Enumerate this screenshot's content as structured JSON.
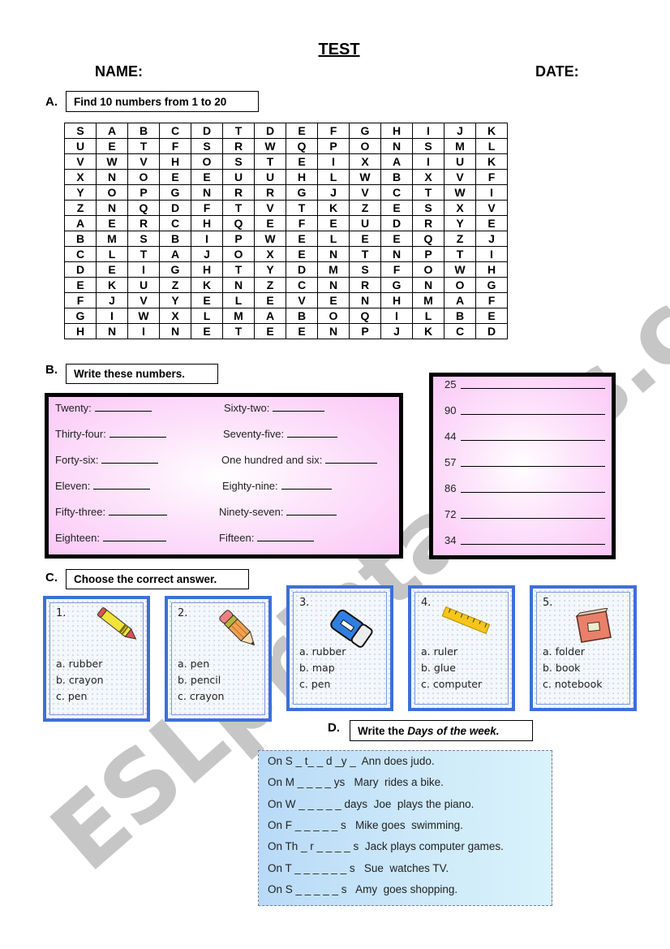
{
  "header": {
    "title": "TEST",
    "name_label": "NAME:",
    "date_label": "DATE:"
  },
  "section_a": {
    "letter": "A.",
    "instruction": "Find 10 numbers from 1 to 20",
    "grid": [
      [
        "S",
        "A",
        "B",
        "C",
        "D",
        "T",
        "D",
        "E",
        "F",
        "G",
        "H",
        "I",
        "J",
        "K"
      ],
      [
        "U",
        "E",
        "T",
        "F",
        "S",
        "R",
        "W",
        "Q",
        "P",
        "O",
        "N",
        "S",
        "M",
        "L"
      ],
      [
        "V",
        "W",
        "V",
        "H",
        "O",
        "S",
        "T",
        "E",
        "I",
        "X",
        "A",
        "I",
        "U",
        "K"
      ],
      [
        "X",
        "N",
        "O",
        "E",
        "E",
        "U",
        "U",
        "H",
        "L",
        "W",
        "B",
        "X",
        "V",
        "F"
      ],
      [
        "Y",
        "O",
        "P",
        "G",
        "N",
        "R",
        "R",
        "G",
        "J",
        "V",
        "C",
        "T",
        "W",
        "I"
      ],
      [
        "Z",
        "N",
        "Q",
        "D",
        "F",
        "T",
        "V",
        "T",
        "K",
        "Z",
        "E",
        "S",
        "X",
        "V"
      ],
      [
        "A",
        "E",
        "R",
        "C",
        "H",
        "Q",
        "E",
        "F",
        "E",
        "U",
        "D",
        "R",
        "Y",
        "E"
      ],
      [
        "B",
        "M",
        "S",
        "B",
        "I",
        "P",
        "W",
        "E",
        "L",
        "E",
        "E",
        "Q",
        "Z",
        "J"
      ],
      [
        "C",
        "L",
        "T",
        "A",
        "J",
        "O",
        "X",
        "E",
        "N",
        "T",
        "N",
        "P",
        "T",
        "I"
      ],
      [
        "D",
        "E",
        "I",
        "G",
        "H",
        "T",
        "Y",
        "D",
        "M",
        "S",
        "F",
        "O",
        "W",
        "H"
      ],
      [
        "E",
        "K",
        "U",
        "Z",
        "K",
        "N",
        "Z",
        "C",
        "N",
        "R",
        "G",
        "N",
        "O",
        "G"
      ],
      [
        "F",
        "J",
        "V",
        "Y",
        "E",
        "L",
        "E",
        "V",
        "E",
        "N",
        "H",
        "M",
        "A",
        "F"
      ],
      [
        "G",
        "I",
        "W",
        "X",
        "L",
        "M",
        "A",
        "B",
        "O",
        "Q",
        "I",
        "L",
        "B",
        "E"
      ],
      [
        "H",
        "N",
        "I",
        "N",
        "E",
        "T",
        "E",
        "E",
        "N",
        "P",
        "J",
        "K",
        "C",
        "D"
      ]
    ]
  },
  "section_b": {
    "letter": "B.",
    "instruction": "Write these numbers.",
    "words_left": [
      "Twenty:",
      "Thirty-four:",
      "Forty-six:",
      "Eleven:",
      "Fifty-three:",
      "Eighteen:"
    ],
    "words_right": [
      "Sixty-two:",
      "Seventy-five:",
      "One hundred and six:",
      "Eighty-nine:",
      "Ninety-seven:",
      "Fifteen:"
    ],
    "numbers": [
      "25",
      "90",
      "44",
      "57",
      "86",
      "72",
      "34"
    ]
  },
  "section_c": {
    "letter": "C.",
    "instruction": "Choose the correct answer.",
    "cards": [
      {
        "num": "1.",
        "icon": "crayon-icon",
        "options": [
          "a. rubber",
          "b. crayon",
          "c. pen"
        ]
      },
      {
        "num": "2.",
        "icon": "pencil-icon",
        "options": [
          "a. pen",
          "b. pencil",
          "c. crayon"
        ]
      },
      {
        "num": "3.",
        "icon": "eraser-icon",
        "options": [
          "a. rubber",
          "b. map",
          "c. pen"
        ]
      },
      {
        "num": "4.",
        "icon": "ruler-icon",
        "options": [
          "a. ruler",
          "b. glue",
          "c. computer"
        ]
      },
      {
        "num": "5.",
        "icon": "book-icon",
        "options": [
          "a. folder",
          "b. book",
          "c. notebook"
        ]
      }
    ]
  },
  "section_d": {
    "letter": "D.",
    "instruction_prefix": "Write the ",
    "instruction_emph": "Days of the week.",
    "lines": [
      "On S _ t_ _ d _y _  Ann does judo.",
      "On M _ _ _ _ ys   Mary  rides a bike.",
      "On W _ _ _ _ _ days  Joe  plays the piano.",
      "On F _ _ _ _ _ s   Mike goes  swimming.",
      "On Th _ r _ _ _ _ s  Jack plays computer games.",
      "On T _ _ _ _ _ _ s   Sue  watches TV.",
      "On S _ _ _ _ _ s   Amy  goes shopping."
    ]
  },
  "watermark": "ESLprintables.com",
  "colors": {
    "card_border": "#3d6fd8",
    "pink_box": "#fbc8f7",
    "days_box": "#b8daf8"
  }
}
